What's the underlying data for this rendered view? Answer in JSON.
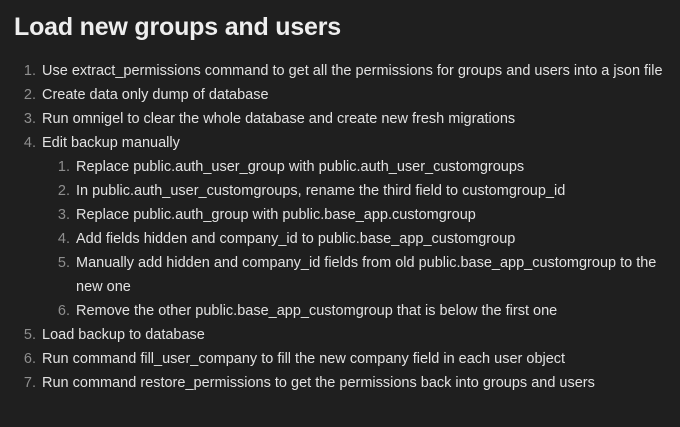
{
  "document": {
    "title": "Load new groups and users",
    "steps": [
      {
        "num": "1.",
        "text": "Use extract_permissions command to get all the permissions for groups and users into a json file"
      },
      {
        "num": "2.",
        "text": "Create data only dump of database"
      },
      {
        "num": "3.",
        "text": "Run omnigel to clear the whole database and create new fresh migrations"
      },
      {
        "num": "4.",
        "text": "Edit backup manually"
      },
      {
        "num": "5.",
        "text": "Load backup to database"
      },
      {
        "num": "6.",
        "text": "Run command fill_user_company to fill the new company field in each user object"
      },
      {
        "num": "7.",
        "text": "Run command restore_permissions to get the permissions back into groups and users"
      }
    ],
    "substeps": [
      {
        "num": "1.",
        "text": "Replace public.auth_user_group with public.auth_user_customgroups"
      },
      {
        "num": "2.",
        "text": "In public.auth_user_customgroups, rename the third field to customgroup_id"
      },
      {
        "num": "3.",
        "text": "Replace public.auth_group with public.base_app.customgroup"
      },
      {
        "num": "4.",
        "text": "Add fields hidden and company_id to public.base_app_customgroup"
      },
      {
        "num": "5.",
        "text": "Manually add hidden and company_id fields from old public.base_app_customgroup to the new one"
      },
      {
        "num": "6.",
        "text": "Remove the other public.base_app_customgroup that is below the first one"
      }
    ]
  }
}
